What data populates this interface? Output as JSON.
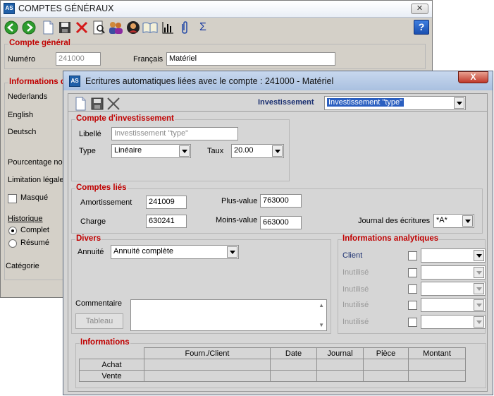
{
  "back_window": {
    "title": "COMPTES GÉNÉRAUX",
    "toolbar": [
      "back-icon",
      "forward-icon",
      "new-icon",
      "save-icon",
      "delete-icon",
      "preview-icon",
      "users-icon",
      "user-icon",
      "book-icon",
      "chart-icon",
      "attach-icon",
      "sum-icon"
    ],
    "help_label": "?",
    "compte_general": {
      "caption": "Compte général",
      "numero_label": "Numéro",
      "numero_value": "241000",
      "francais_label": "Français",
      "francais_value": "Matériel"
    },
    "informations_caption": "Informations d",
    "nederlands": "Nederlands",
    "english": "English",
    "deutsch": "Deutsch",
    "pourcentage": "Pourcentage non",
    "limitation": "Limitation légale",
    "masque": "Masqué",
    "historique": "Historique",
    "complet": "Complet",
    "resume": "Résumé",
    "categorie": "Catégorie"
  },
  "dialog": {
    "title": "Ecritures automatiques liées avec le compte : 241000 - Matériel",
    "close_label": "X",
    "investissement_label": "Investissement",
    "investissement_value": "Investissement \"type\"",
    "compte_investissement": {
      "caption": "Compte d'investissement",
      "libelle_label": "Libellé",
      "libelle_value": "Investissement \"type\"",
      "type_label": "Type",
      "type_value": "Linéaire",
      "taux_label": "Taux",
      "taux_value": "20.00"
    },
    "comptes_lies": {
      "caption": "Comptes liés",
      "amortissement_label": "Amortissement",
      "amortissement_value": "241009",
      "charge_label": "Charge",
      "charge_value": "630241",
      "plus_value_label": "Plus-value",
      "plus_value_value": "763000",
      "moins_value_label": "Moins-value",
      "moins_value_value": "663000",
      "journal_label": "Journal des écritures",
      "journal_value": "*A*"
    },
    "divers": {
      "caption": "Divers",
      "annuite_label": "Annuité",
      "annuite_value": "Annuité complète",
      "commentaire_label": "Commentaire",
      "tableau_label": "Tableau"
    },
    "analytiques": {
      "caption": "Informations analytiques",
      "rows": [
        "Client",
        "Inutilisé",
        "Inutilisé",
        "Inutilisé",
        "Inutilisé"
      ]
    },
    "informations": {
      "caption": "Informations",
      "columns": [
        "Fourn./Client",
        "Date",
        "Journal",
        "Pièce",
        "Montant"
      ],
      "rows": [
        "Achat",
        "Vente"
      ]
    }
  }
}
